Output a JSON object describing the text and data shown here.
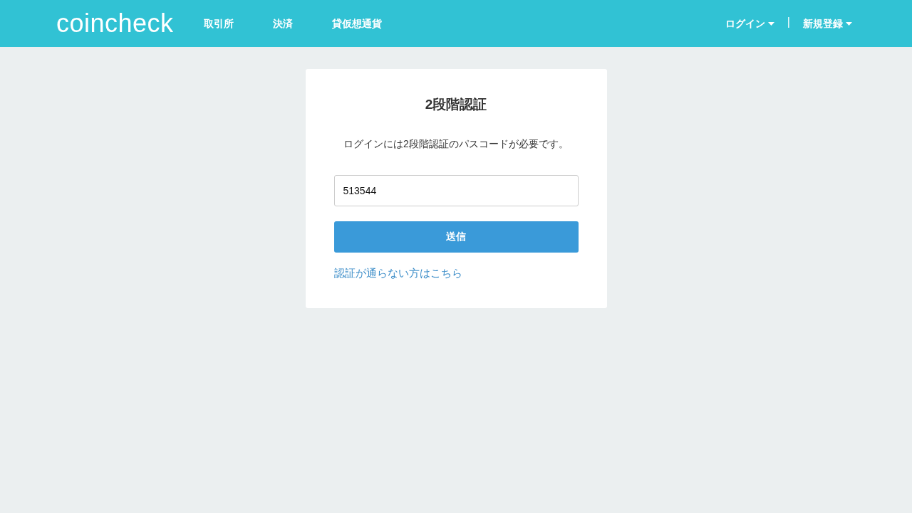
{
  "header": {
    "logo": "coincheck",
    "nav": [
      "取引所",
      "決済",
      "貸仮想通貨"
    ],
    "right_menu": [
      {
        "label": "ログイン"
      },
      {
        "label": "新規登録"
      }
    ],
    "separator": "|"
  },
  "card": {
    "title": "2段階認証",
    "description": "ログインには2段階認証のパスコードが必要です。",
    "passcode": {
      "value": "513544"
    },
    "submit": "送信",
    "help_link": "認証が通らない方はこちら"
  }
}
